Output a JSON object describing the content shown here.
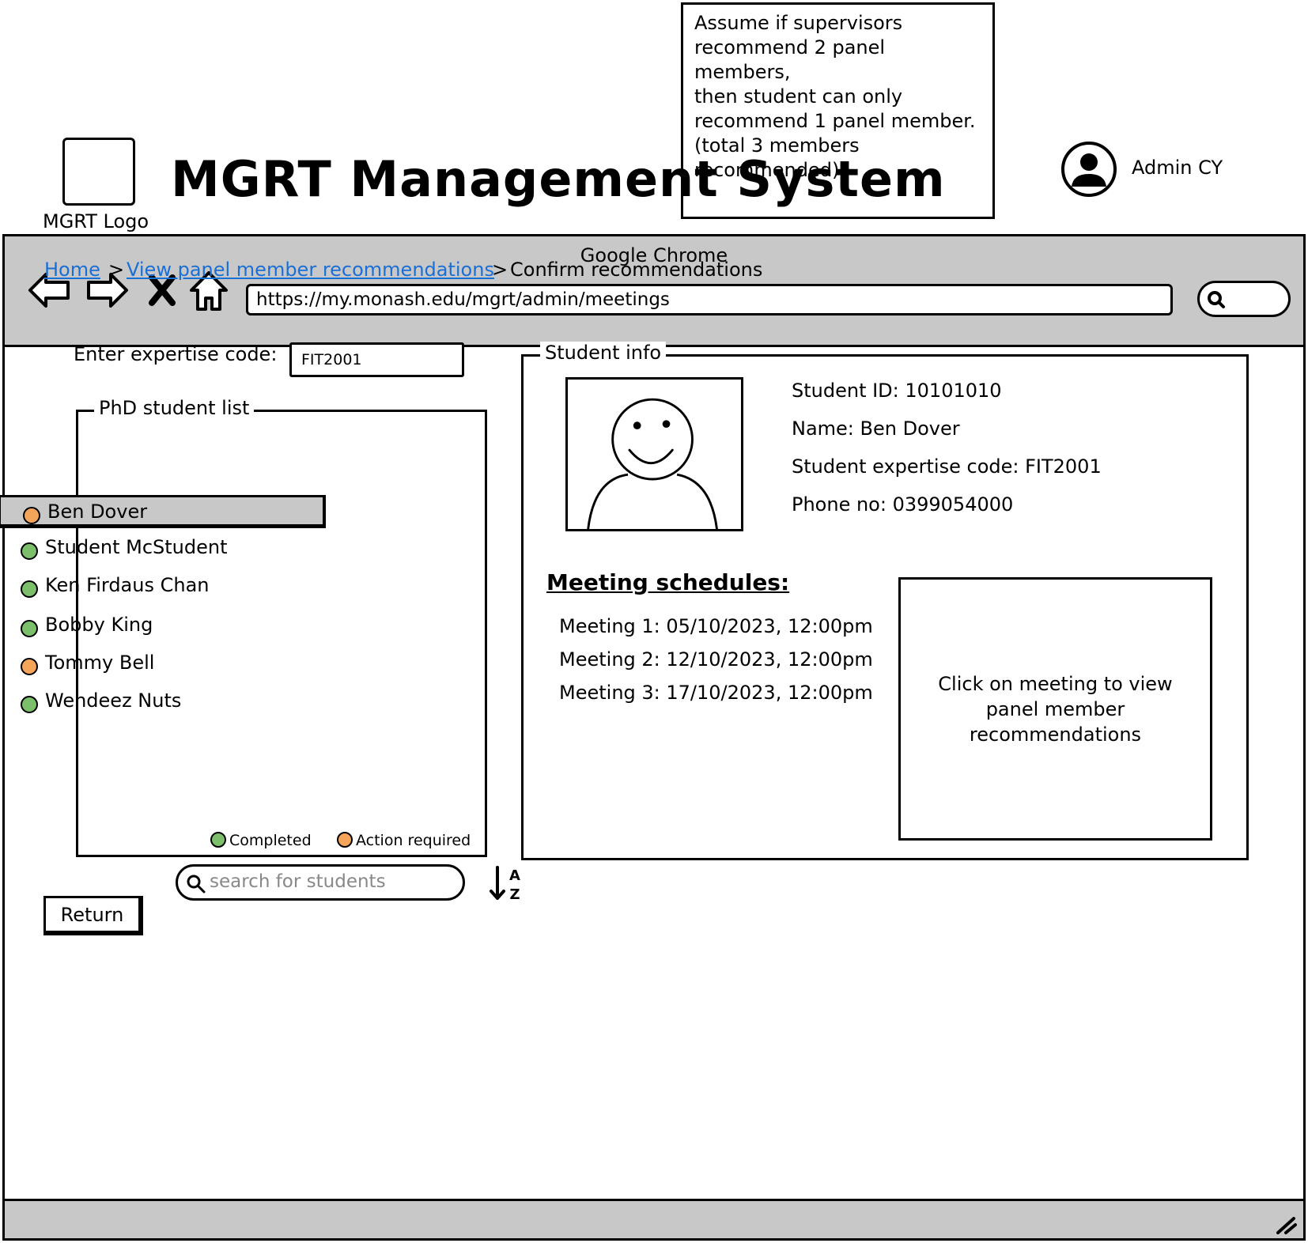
{
  "note": {
    "lines": [
      "Assume if supervisors",
      "recommend 2 panel members,",
      "then student can only",
      "recommend 1 panel member.",
      "(total 3 members",
      "recommended)"
    ]
  },
  "browser": {
    "title": "Google Chrome",
    "url": "https://my.monash.edu/mgrt/admin/meetings",
    "icons": [
      "back-icon",
      "forward-icon",
      "close-icon",
      "home-icon",
      "search-icon"
    ]
  },
  "header": {
    "logo_label": "MGRT Logo",
    "app_title": "MGRT Management System",
    "user_name": "Admin CY"
  },
  "breadcrumb": {
    "items": [
      "Home",
      "View panel member recommendations",
      "Confirm recommendations"
    ],
    "separator": ">"
  },
  "expertise": {
    "label": "Enter expertise code:",
    "value": "FIT2001"
  },
  "student_list": {
    "legend": "PhD student list",
    "search_placeholder": "search for students",
    "students": [
      {
        "name": "Ben Dover",
        "status": "action",
        "selected": true
      },
      {
        "name": "Student McStudent",
        "status": "completed",
        "selected": false
      },
      {
        "name": "Ken Firdaus Chan",
        "status": "completed",
        "selected": false
      },
      {
        "name": "Bobby King",
        "status": "completed",
        "selected": false
      },
      {
        "name": "Tommy Bell",
        "status": "action",
        "selected": false
      },
      {
        "name": "Wendeez Nuts",
        "status": "completed",
        "selected": false
      }
    ],
    "key": {
      "completed": "Completed",
      "action": "Action required"
    }
  },
  "colors": {
    "completed": "#7cbf6b",
    "action": "#f5a55a",
    "selected_bg": "#c8c8c8",
    "link": "#1a6fd6",
    "chrome": "#c8c8c8"
  },
  "student_info": {
    "legend": "Student info",
    "id_line": "Student ID: 10101010",
    "name_line": "Name: Ben Dover",
    "expertise_line": "Student expertise code: FIT2001",
    "phone_line": "Phone no: 0399054000"
  },
  "meetings": {
    "heading": "Meeting schedules:",
    "items": [
      "Meeting 1: 05/10/2023, 12:00pm",
      "Meeting 2: 12/10/2023, 12:00pm",
      "Meeting 3: 17/10/2023, 12:00pm"
    ],
    "panel_hint": "Click on meeting to view panel member recommendations"
  },
  "actions": {
    "return_label": "Return"
  }
}
